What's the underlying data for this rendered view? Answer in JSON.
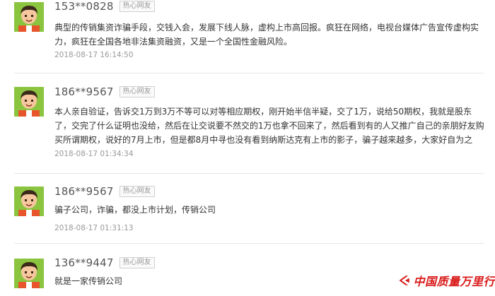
{
  "comments": [
    {
      "username": "153**0828",
      "badge": "热心网友",
      "content": "典型的传销集资诈骗手段，交钱入会，发展下线人脉，虚构上市高回报。疯狂在网络，电视台媒体广告宣传虚构实力，疯狂在全国各地非法集资融资，又是一个全国性金融风险。",
      "timestamp": "2018-08-17 16:14:50"
    },
    {
      "username": "186**9567",
      "badge": "热心网友",
      "content": "本人亲自验证，告诉交1万到3万不等可以对等相应期权，刚开始半信半疑，交了1万，说给50期权，我就是股东了，交完了什么证明也没给，然后在让交说要不然交的1万也拿不回来了，然后看到有的人又推广自己的亲朋好友购买所谓期权，说好的7月上市，但是都8月中寻也没有看到纳斯达克有上市的影子，骗子越来越多，大家好自为之",
      "timestamp": "2018-08-17 01:34:34"
    },
    {
      "username": "186**9567",
      "badge": "热心网友",
      "content": "骗子公司，诈骗，都没上市计划，传销公司",
      "timestamp": "2018-08-17 01:31:13"
    },
    {
      "username": "136**9447",
      "badge": "热心网友",
      "content": "就是一家传销公司",
      "timestamp": ""
    }
  ],
  "watermark": {
    "text": "中国质量万里行",
    "logo_icon": "quality-logo-icon",
    "color": "#d91a1a"
  },
  "avatar_icon": "user-avatar-icon",
  "colors": {
    "avatar_bg": "#8bc53f",
    "avatar_face": "#f6c79e",
    "avatar_hair": "#3b2a1a",
    "avatar_shirt": "#e8542c"
  }
}
